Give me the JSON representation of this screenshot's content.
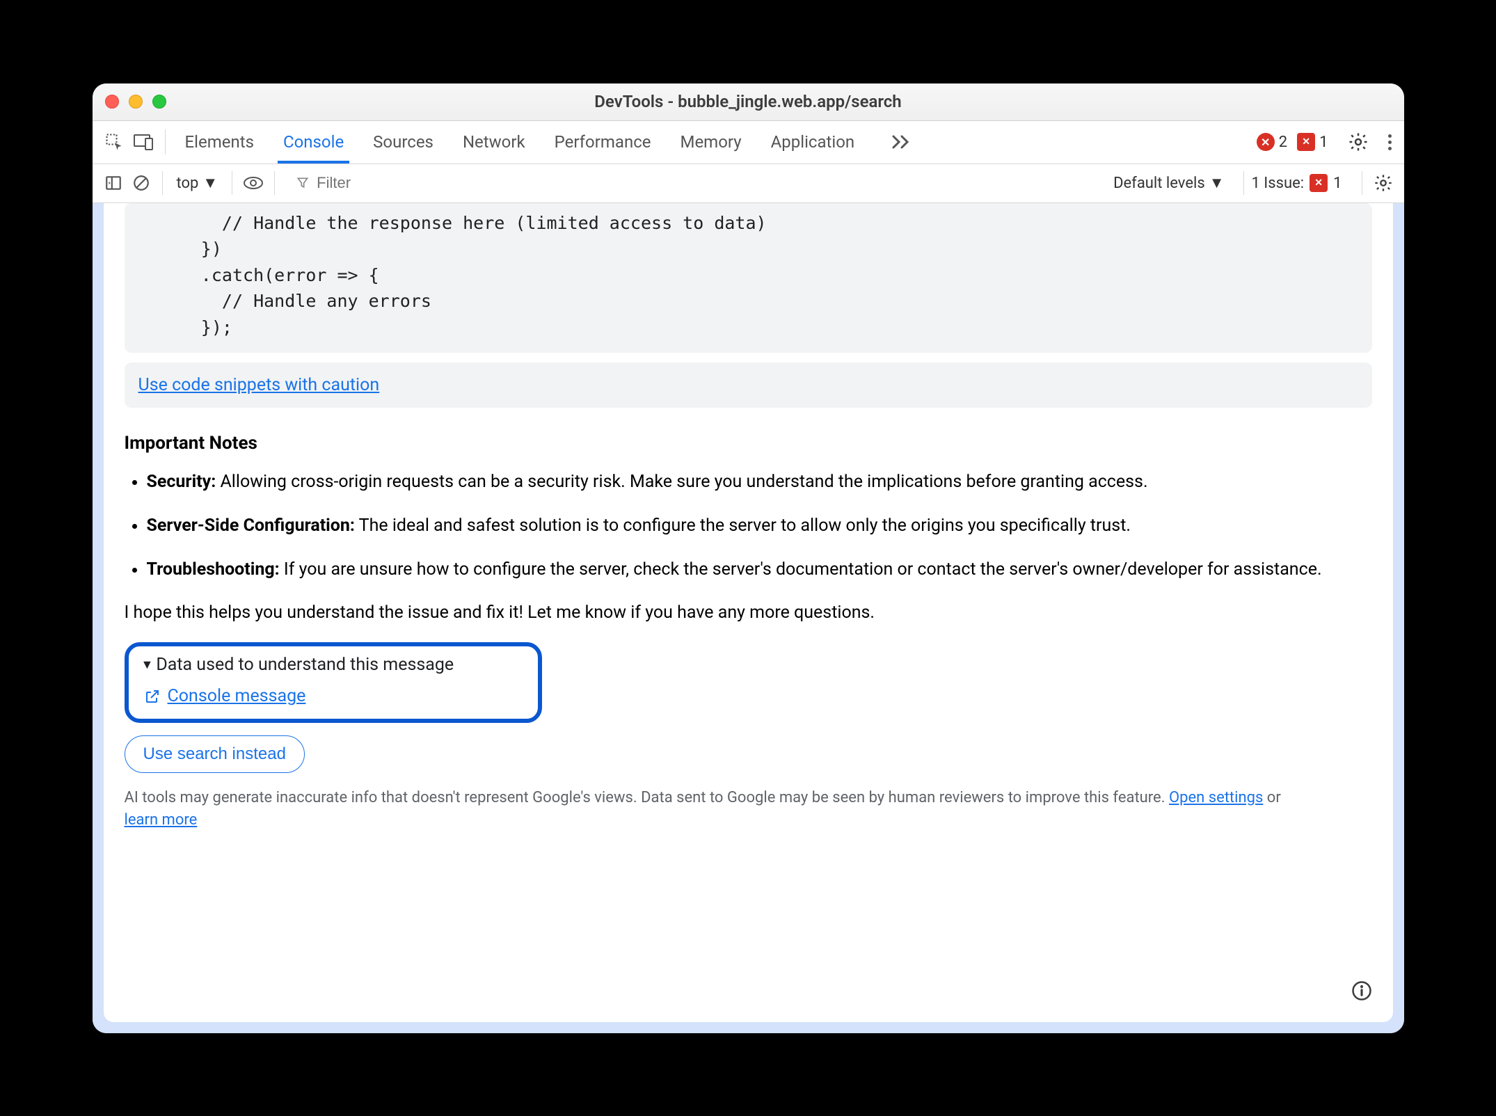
{
  "window": {
    "title": "DevTools - bubble_jingle.web.app/search"
  },
  "tabs": {
    "elements": "Elements",
    "console": "Console",
    "sources": "Sources",
    "network": "Network",
    "performance": "Performance",
    "memory": "Memory",
    "application": "Application"
  },
  "error_count": "2",
  "issue_count_top": "1",
  "subbar": {
    "context": "top",
    "filter_placeholder": "Filter",
    "levels": "Default levels",
    "issues_label": "1 Issue:",
    "issues_count": "1"
  },
  "code": "        // Handle the response here (limited access to data)\n      })\n      .catch(error => {\n        // Handle any errors\n      });",
  "caution_link": "Use code snippets with caution",
  "notes_title": "Important Notes",
  "note1_b": "Security:",
  "note1_t": " Allowing cross-origin requests can be a security risk. Make sure you understand the implications before granting access.",
  "note2_b": "Server-Side Configuration:",
  "note2_t": " The ideal and safest solution is to configure the server to allow only the origins you specifically trust.",
  "note3_b": "Troubleshooting:",
  "note3_t": " If you are unsure how to configure the server, check the server's documentation or contact the server's owner/developer for assistance.",
  "closing": "I hope this helps you understand the issue and fix it! Let me know if you have any more questions.",
  "data_box": {
    "summary": "Data used to understand this message",
    "link": "Console message"
  },
  "search_btn": "Use search instead",
  "disclaimer": {
    "pre": "AI tools may generate inaccurate info that doesn't represent Google's views. Data sent to Google may be seen by human reviewers to improve this feature. ",
    "settings": "Open settings",
    "mid": " or ",
    "learn": "learn more"
  }
}
